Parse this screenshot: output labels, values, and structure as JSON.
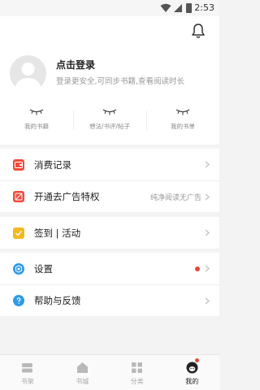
{
  "status_bar": {
    "time": "2:53",
    "icons": [
      "wifi-icon",
      "signal-icon",
      "battery-icon"
    ]
  },
  "header": {
    "bell_icon": "bell-icon",
    "login_title": "点击登录",
    "login_subtitle": "登录更安全,可同步书籍,查看阅读时长",
    "stats": [
      {
        "label": "我的书籍"
      },
      {
        "label": "想法/书评/帖子"
      },
      {
        "label": "我的书单"
      }
    ]
  },
  "menu_groups": [
    {
      "items": [
        {
          "label": "消费记录",
          "icon": "receipt-icon",
          "color": "#f04b3c"
        },
        {
          "label": "开通去广告特权",
          "icon": "no-ads-icon",
          "color": "#f04b3c",
          "right_text": "纯净阅读无广告"
        }
      ]
    },
    {
      "items": [
        {
          "label": "签到 | 活动",
          "icon": "checkin-icon",
          "color": "#f3b820"
        }
      ]
    },
    {
      "items": [
        {
          "label": "设置",
          "icon": "settings-icon",
          "color": "#2e9be8",
          "badge": true
        },
        {
          "label": "帮助与反馈",
          "icon": "help-icon",
          "color": "#2e9be8"
        }
      ]
    }
  ],
  "tab_bar": {
    "tabs": [
      {
        "label": "书架",
        "icon": "bookshelf-icon"
      },
      {
        "label": "书城",
        "icon": "bookstore-icon"
      },
      {
        "label": "分类",
        "icon": "category-icon"
      },
      {
        "label": "我的",
        "icon": "profile-icon",
        "active": true,
        "badge": true
      }
    ]
  }
}
